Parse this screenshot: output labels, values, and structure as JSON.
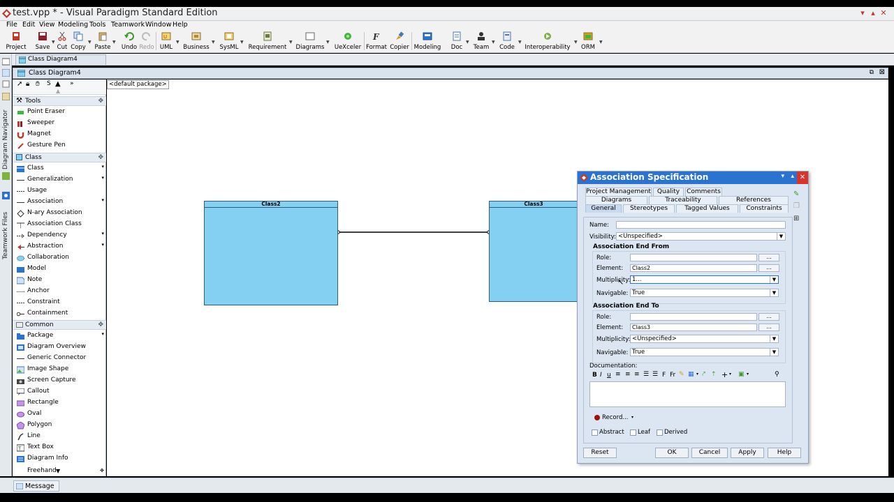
{
  "window": {
    "title": "test.vpp * - Visual Paradigm Standard Edition"
  },
  "menu": [
    "File",
    "Edit",
    "View",
    "Modeling",
    "Tools",
    "Teamwork",
    "Window",
    "Help"
  ],
  "toolbar": [
    "Project",
    "Save",
    "Cut",
    "Copy",
    "Paste",
    "Undo",
    "Redo",
    "UML",
    "Business",
    "SysML",
    "Requirement",
    "Diagrams",
    "UeXceler",
    "Format",
    "Copier",
    "Modeling",
    "Doc",
    "Team",
    "Code",
    "Interoperability",
    "ORM"
  ],
  "tabs": {
    "document": "Class Diagram4"
  },
  "left_strip": {
    "top": "Diagram Navigator",
    "bottom": "Teamwork Files"
  },
  "diagram": {
    "title": "Class Diagram4",
    "package": "<default package>"
  },
  "palette": {
    "cat_tools": "Tools",
    "tools": [
      "Point Eraser",
      "Sweeper",
      "Magnet",
      "Gesture Pen"
    ],
    "cat_class": "Class",
    "class_items": [
      "Class",
      "Generalization",
      "Usage",
      "Association",
      "N-ary Association",
      "Association Class",
      "Dependency",
      "Abstraction",
      "Collaboration",
      "Model",
      "Note",
      "Anchor",
      "Constraint",
      "Containment"
    ],
    "cat_common": "Common",
    "common_items": [
      "Package",
      "Diagram Overview",
      "Generic Connector",
      "Image Shape",
      "Screen Capture",
      "Callout",
      "Rectangle",
      "Oval",
      "Polygon",
      "Line",
      "Text Box",
      "Diagram Info",
      "Freehand"
    ]
  },
  "canvas": {
    "class1": "Class2",
    "class2": "Class3"
  },
  "status": {
    "message_tab": "Message"
  },
  "dialog": {
    "title": "Association Specification",
    "tabs_row1": [
      "Project Management",
      "Quality",
      "Comments"
    ],
    "tabs_row2": [
      "Diagrams",
      "Traceability",
      "References"
    ],
    "tabs_row3": [
      "General",
      "Stereotypes",
      "Tagged Values",
      "Constraints"
    ],
    "name_label": "Name:",
    "name_value": "",
    "visibility_label": "Visibility:",
    "visibility_value": "<Unspecified>",
    "end_from": {
      "header": "Association End From",
      "role_label": "Role:",
      "role_value": "",
      "element_label": "Element:",
      "element_value": "Class2",
      "multiplicity_label": "Multiplicity:",
      "multiplicity_value": "1...",
      "navigable_label": "Navigable:",
      "navigable_value": "True"
    },
    "end_to": {
      "header": "Association End To",
      "role_label": "Role:",
      "role_value": "",
      "element_label": "Element:",
      "element_value": "Class3",
      "multiplicity_label": "Multiplicity:",
      "multiplicity_value": "<Unspecified>",
      "navigable_label": "Navigable:",
      "navigable_value": "True"
    },
    "documentation_label": "Documentation:",
    "record_label": "Record...",
    "checkboxes": [
      "Abstract",
      "Leaf",
      "Derived"
    ],
    "buttons": {
      "reset": "Reset",
      "ok": "OK",
      "cancel": "Cancel",
      "apply": "Apply",
      "help": "Help"
    },
    "dots": "..."
  },
  "colors": {
    "class_fill": "#83d0f3",
    "dialog_title": "#2b73d0",
    "close_red": "#d9342b"
  }
}
